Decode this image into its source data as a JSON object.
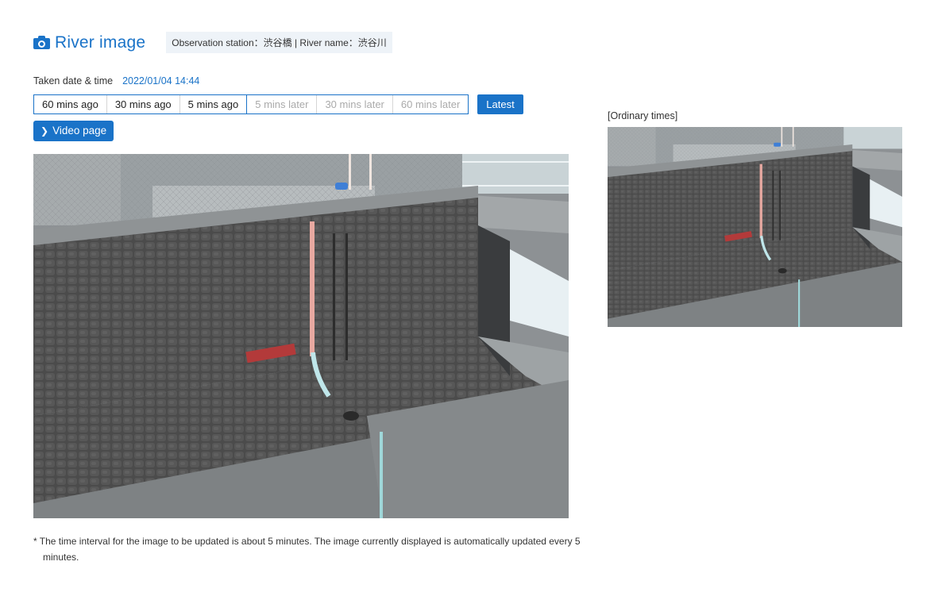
{
  "header": {
    "icon": "camera-icon",
    "title": "River image",
    "station_info": "Observation station：渋谷橋 | River name：渋谷川"
  },
  "taken": {
    "label": "Taken date & time",
    "value": "2022/01/04 14:44"
  },
  "time_buttons": [
    {
      "label": "60 mins ago",
      "enabled": true
    },
    {
      "label": "30 mins ago",
      "enabled": true
    },
    {
      "label": "5 mins ago",
      "enabled": true
    },
    {
      "label": "5 mins later",
      "enabled": false
    },
    {
      "label": "30 mins later",
      "enabled": false
    },
    {
      "label": "60 mins later",
      "enabled": false
    }
  ],
  "latest_label": "Latest",
  "video_button": {
    "icon": "chevron-right-icon",
    "label": "Video page"
  },
  "main_image": {
    "alt": "River camera image"
  },
  "reference": {
    "label": "[Ordinary times]",
    "alt": "River camera image at ordinary times"
  },
  "note": "* The time interval for the image to be updated is about 5 minutes. The image currently displayed is automatically updated every 5 minutes.",
  "colors": {
    "accent": "#1a73c8",
    "station_bg": "#eef3f8",
    "disabled_text": "#aaaaaa"
  }
}
